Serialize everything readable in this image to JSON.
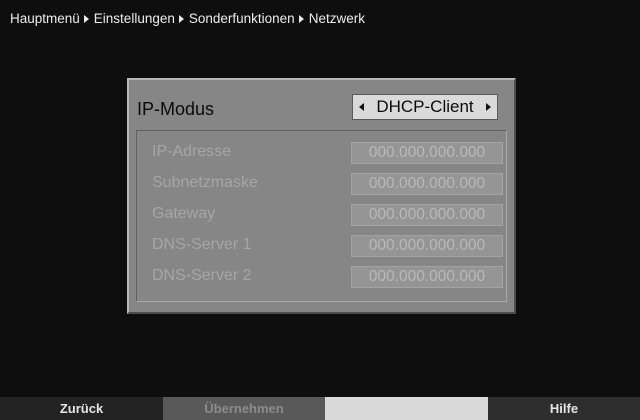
{
  "breadcrumb": [
    "Hauptmenü",
    "Einstellungen",
    "Sonderfunktionen",
    "Netzwerk"
  ],
  "ip_mode": {
    "label": "IP-Modus",
    "value": "DHCP-Client"
  },
  "fields": [
    {
      "label": "IP-Adresse",
      "value": "000.000.000.000"
    },
    {
      "label": "Subnetzmaske",
      "value": "000.000.000.000"
    },
    {
      "label": "Gateway",
      "value": "000.000.000.000"
    },
    {
      "label": "DNS-Server 1",
      "value": "000.000.000.000"
    },
    {
      "label": "DNS-Server 2",
      "value": "000.000.000.000"
    }
  ],
  "footer": {
    "back_label": "Zurück",
    "apply_label": "Übernehmen",
    "blank_label": "",
    "help_label": "Hilfe"
  },
  "colors": {
    "background": "#0e0e0e",
    "panel": "#868686",
    "selector": "#dadada",
    "footer_red_slot": "#232323",
    "footer_green_slot": "#595959",
    "footer_yellow_slot": "#d9d9d9",
    "footer_blue_slot": "#2e2e2e"
  }
}
